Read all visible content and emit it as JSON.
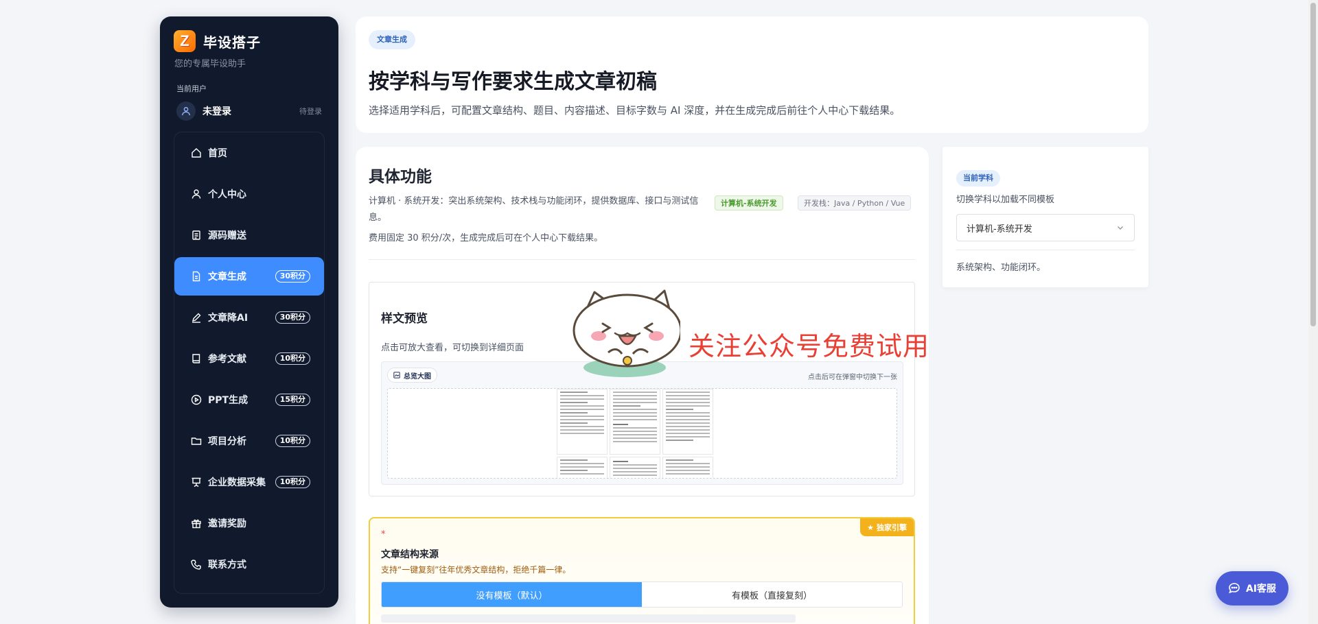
{
  "brand": {
    "logo_letter": "Z",
    "name": "毕设搭子",
    "subtitle": "您的专属毕设助手"
  },
  "user": {
    "label": "当前用户",
    "name": "未登录",
    "status": "待登录"
  },
  "sidebar": {
    "items": [
      {
        "label": "首页",
        "icon": "home-icon",
        "badge": ""
      },
      {
        "label": "个人中心",
        "icon": "user-icon",
        "badge": ""
      },
      {
        "label": "源码赠送",
        "icon": "code-doc-icon",
        "badge": ""
      },
      {
        "label": "文章生成",
        "icon": "document-icon",
        "badge": "30积分",
        "active": true
      },
      {
        "label": "文章降AI",
        "icon": "pen-icon",
        "badge": "30积分"
      },
      {
        "label": "参考文献",
        "icon": "book-icon",
        "badge": "10积分"
      },
      {
        "label": "PPT生成",
        "icon": "play-icon",
        "badge": "15积分"
      },
      {
        "label": "项目分析",
        "icon": "folder-icon",
        "badge": "10积分"
      },
      {
        "label": "企业数据采集",
        "icon": "presentation-icon",
        "badge": "10积分"
      },
      {
        "label": "邀请奖励",
        "icon": "gift-icon",
        "badge": ""
      },
      {
        "label": "联系方式",
        "icon": "phone-icon",
        "badge": ""
      }
    ]
  },
  "header": {
    "pill": "文章生成",
    "title": "按学科与写作要求生成文章初稿",
    "description": "选择适用学科后，可配置文章结构、题目、内容描述、目标字数与 AI 深度，并在生成完成后前往个人中心下载结果。"
  },
  "main": {
    "title": "具体功能",
    "description": "计算机 · 系统开发：突出系统架构、技术栈与功能闭环，提供数据库、接口与测试信息。",
    "tag_subject": "计算机-系统开发",
    "tag_stack": "开发栈：Java / Python / Vue",
    "fee": "费用固定 30 积分/次，生成完成后可在个人中心下载结果。",
    "preview": {
      "title": "样文预览",
      "hint": "点击可放大查看，可切换到详细页面",
      "overview_button": "总览大图",
      "viewer_tip": "点击后可在弹窗中切换下一张"
    },
    "structure": {
      "ribbon": "独家引擎",
      "required_mark": "*",
      "title": "文章结构来源",
      "subtitle": "支持“一键复刻”往年优秀文章结构，拒绝千篇一律。",
      "option_none": "没有模板（默认）",
      "option_template": "有模板（直接复刻）"
    }
  },
  "subject": {
    "pill": "当前学科",
    "tip": "切换学科以加载不同模板",
    "selected": "计算机-系统开发",
    "note": "系统架构、功能闭环。"
  },
  "promo": {
    "text": "关注公众号免费试用"
  },
  "ai_service": {
    "label": "AI客服"
  },
  "colors": {
    "sidebar_bg": "#111a2c",
    "accent": "#3f8cff",
    "promo_red": "#ea3f35",
    "ai_button": "#4b5bd8",
    "ribbon": "#f3b21c"
  }
}
